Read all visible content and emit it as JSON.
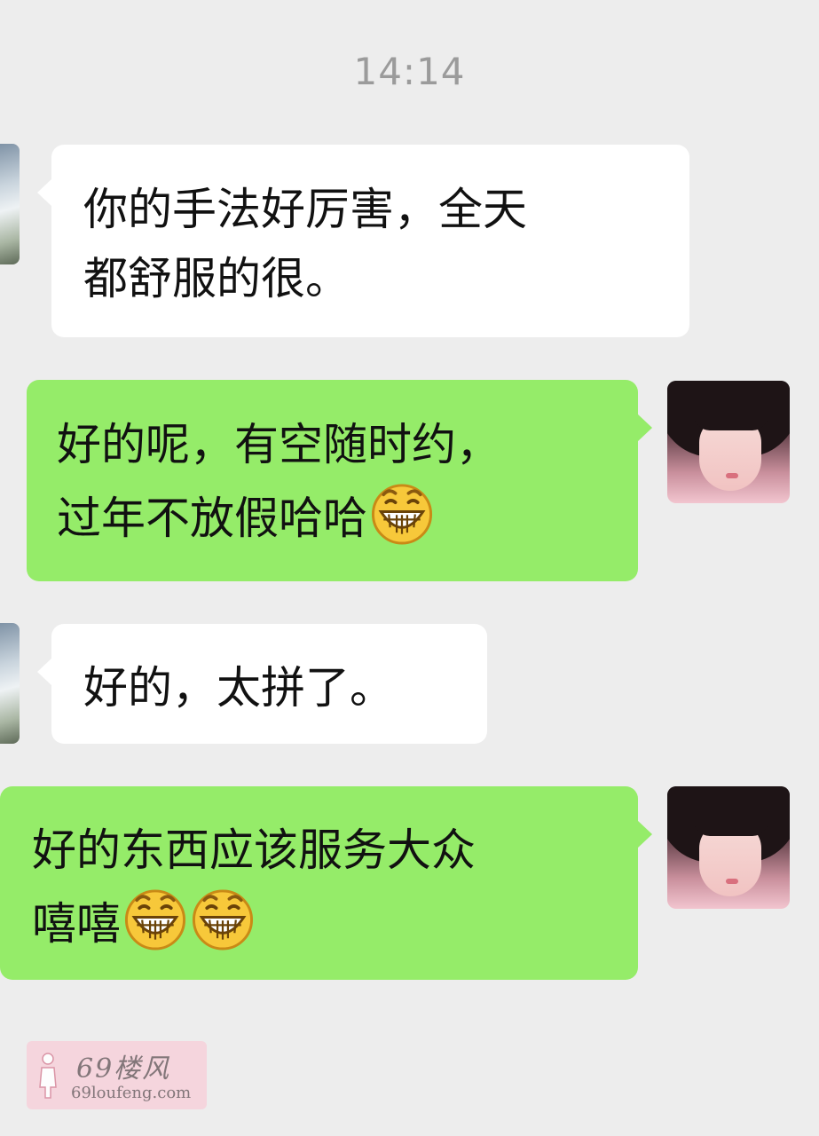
{
  "chat": {
    "timestamp": "14:14",
    "messages": [
      {
        "side": "in",
        "text": "你的手法好厉害，全天\n都舒服的很。",
        "emoji_count": 0
      },
      {
        "side": "out",
        "text": "好的呢，有空随时约，\n过年不放假哈哈",
        "emoji_count": 1
      },
      {
        "side": "in",
        "text": "好的，太拼了。",
        "emoji_count": 0
      },
      {
        "side": "out",
        "text": "好的东西应该服务大众\n嘻嘻",
        "emoji_count": 2
      }
    ],
    "emoji_icon": "grinning-face-icon"
  },
  "watermark": {
    "brand": "69楼风",
    "domain": "69loufeng.com"
  },
  "colors": {
    "background": "#ededed",
    "incoming_bubble": "#ffffff",
    "outgoing_bubble": "#95ec69",
    "timestamp_text": "#9b9b9b"
  }
}
